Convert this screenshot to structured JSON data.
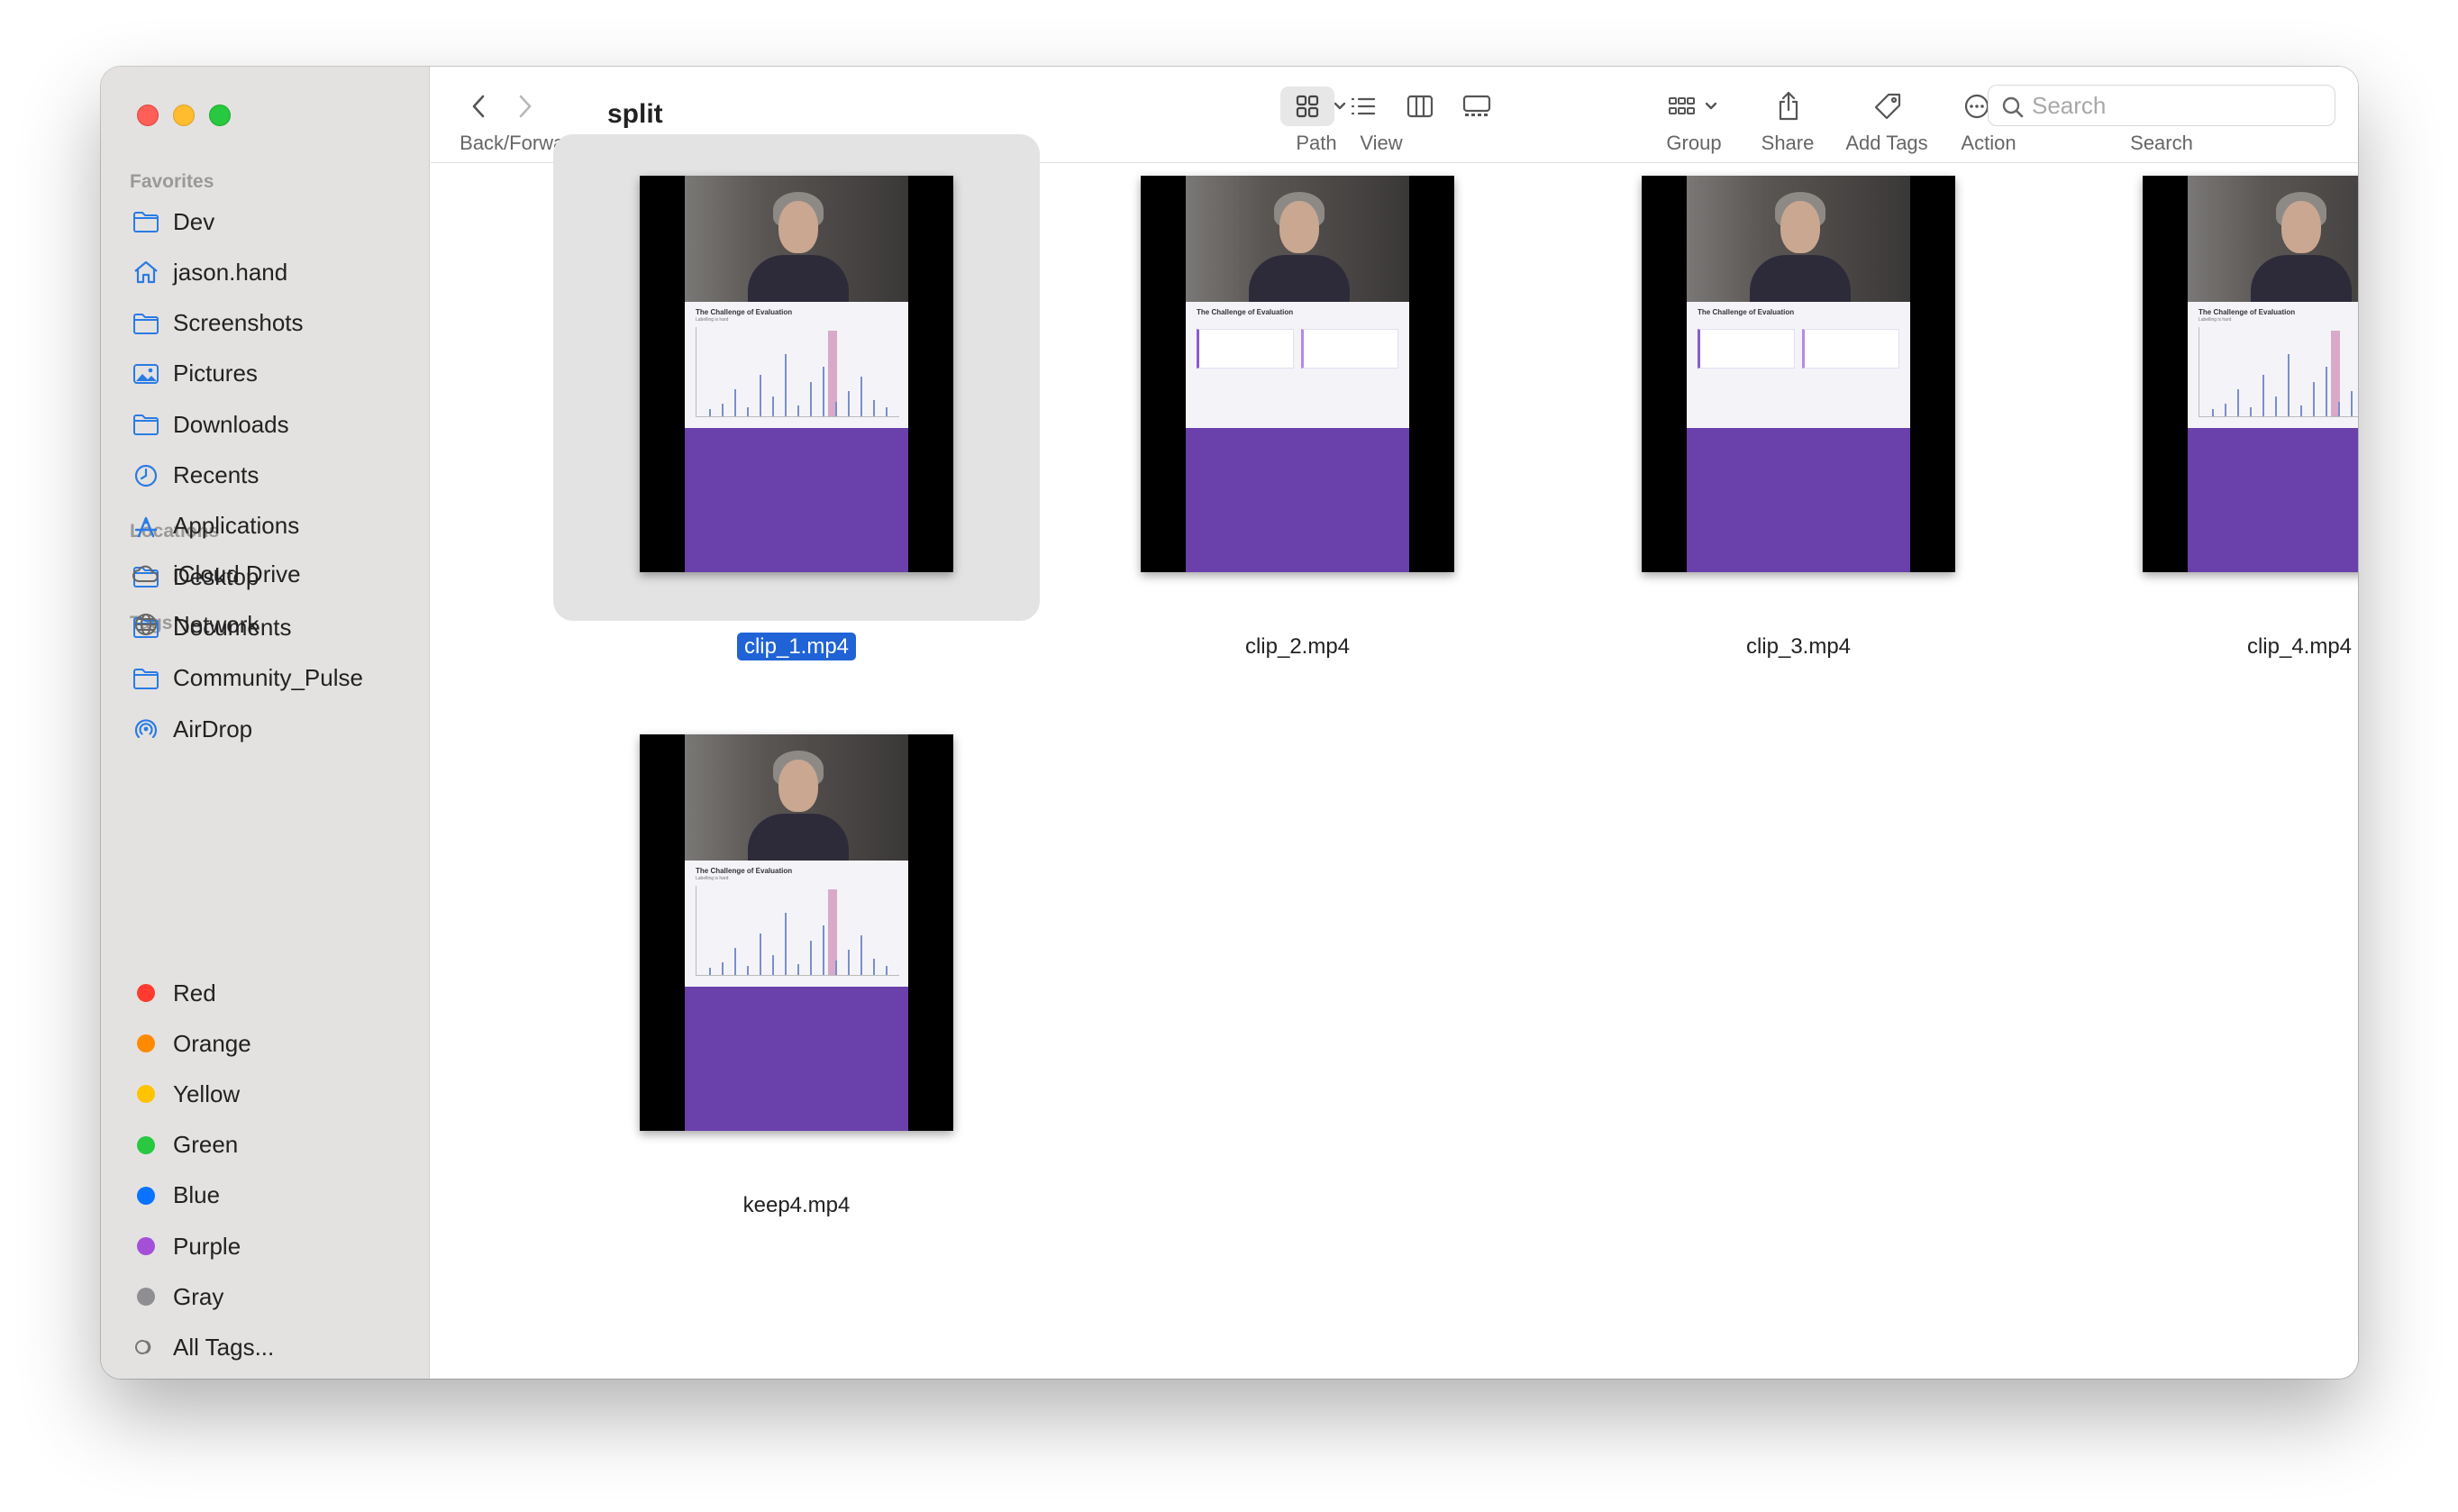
{
  "window": {
    "title": "split"
  },
  "toolbar": {
    "back_forward_label": "Back/Forward",
    "path_label": "Path",
    "view_label": "View",
    "group_label": "Group",
    "share_label": "Share",
    "add_tags_label": "Add Tags",
    "action_label": "Action",
    "search_label": "Search",
    "search_placeholder": "Search"
  },
  "sidebar": {
    "favorites_header": "Favorites",
    "favorites": [
      {
        "label": "Dev",
        "icon": "folder-icon"
      },
      {
        "label": "jason.hand",
        "icon": "home-icon"
      },
      {
        "label": "Screenshots",
        "icon": "folder-icon"
      },
      {
        "label": "Pictures",
        "icon": "pictures-icon"
      },
      {
        "label": "Downloads",
        "icon": "folder-icon"
      },
      {
        "label": "Recents",
        "icon": "clock-icon"
      },
      {
        "label": "Applications",
        "icon": "applications-icon"
      },
      {
        "label": "Desktop",
        "icon": "folder-icon"
      },
      {
        "label": "Documents",
        "icon": "folder-icon"
      },
      {
        "label": "Community_Pulse",
        "icon": "folder-icon"
      },
      {
        "label": "AirDrop",
        "icon": "airdrop-icon"
      }
    ],
    "locations_header": "Locations",
    "locations": [
      {
        "label": "iCloud Drive",
        "icon": "cloud-icon"
      },
      {
        "label": "Network",
        "icon": "globe-icon"
      }
    ],
    "tags_header": "Tags",
    "tags": [
      {
        "label": "Red",
        "color": "#ff3b30"
      },
      {
        "label": "Orange",
        "color": "#ff8a00"
      },
      {
        "label": "Yellow",
        "color": "#ffc300"
      },
      {
        "label": "Green",
        "color": "#28c840"
      },
      {
        "label": "Blue",
        "color": "#0a72ff"
      },
      {
        "label": "Purple",
        "color": "#a54fd8"
      },
      {
        "label": "Gray",
        "color": "#8e8e93"
      },
      {
        "label": "All Tags...",
        "color": ""
      }
    ]
  },
  "files": [
    {
      "name": "clip_1.mp4",
      "selected": true,
      "slide_title": "The Challenge of Evaluation",
      "slide_sub": "Labelling is hard",
      "kind": "chart"
    },
    {
      "name": "clip_2.mp4",
      "selected": false,
      "slide_title": "The Challenge of Evaluation",
      "slide_sub": "",
      "kind": "cards"
    },
    {
      "name": "clip_3.mp4",
      "selected": false,
      "slide_title": "The Challenge of Evaluation",
      "slide_sub": "",
      "kind": "cards"
    },
    {
      "name": "clip_4.mp4",
      "selected": false,
      "slide_title": "The Challenge of Evaluation",
      "slide_sub": "Labelling is hard",
      "kind": "chart"
    },
    {
      "name": "keep4.mp4",
      "selected": false,
      "slide_title": "The Challenge of Evaluation",
      "slide_sub": "Labelling is hard",
      "kind": "chart"
    }
  ]
}
